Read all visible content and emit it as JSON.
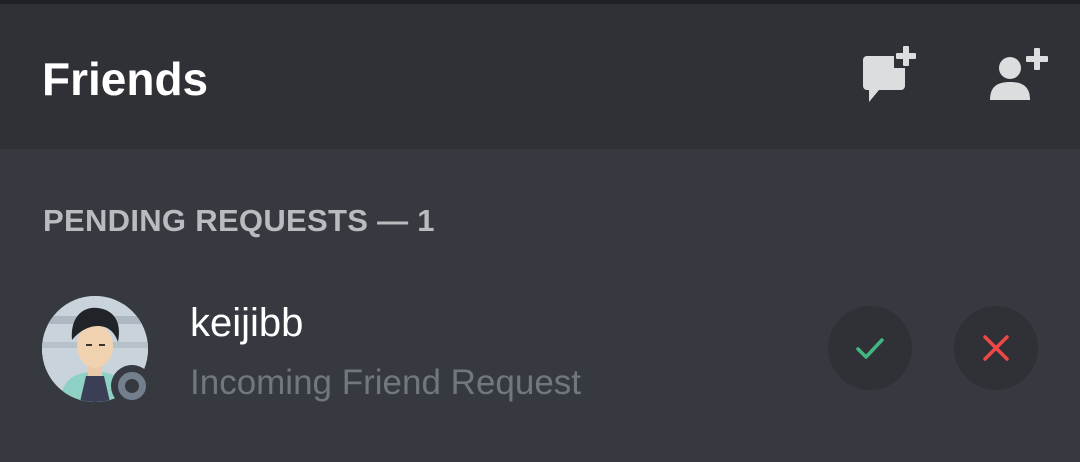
{
  "header": {
    "title": "Friends",
    "new_dm_icon": "chat-plus-icon",
    "add_friend_icon": "person-plus-icon"
  },
  "pending": {
    "section_label": "PENDING REQUESTS — 1",
    "requests": [
      {
        "username": "keijibb",
        "subtitle": "Incoming Friend Request",
        "status": "offline",
        "accept_icon": "check-icon",
        "decline_icon": "close-icon"
      }
    ]
  },
  "colors": {
    "background": "#36393f",
    "header": "#2f3136",
    "accept": "#43b581",
    "decline": "#f04747",
    "muted": "#72767d"
  }
}
